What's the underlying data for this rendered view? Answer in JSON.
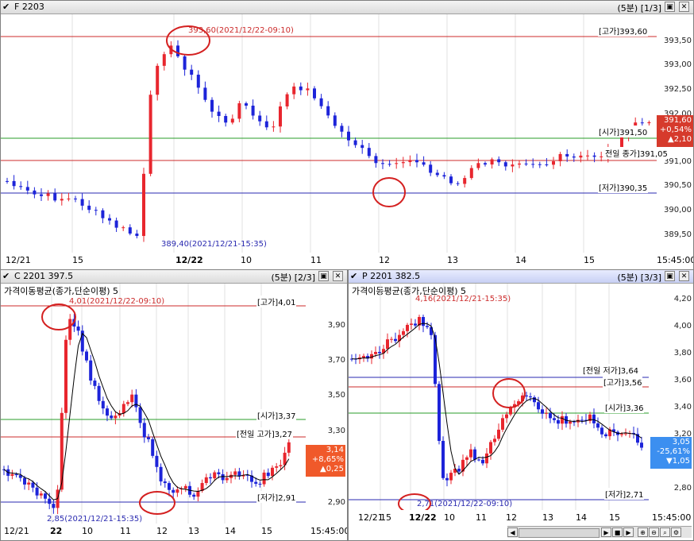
{
  "colors": {
    "up": "#e8262e",
    "down": "#1d24d9",
    "high_line": "#cc2b2b",
    "low_line": "#2a2ab0",
    "open_line": "#2a9d2a"
  },
  "panel1": {
    "check": "✔",
    "code": "F 2203",
    "period": "(5분)",
    "page": "[1/3]",
    "y_labels": [
      "393,50",
      "393,00",
      "392,50",
      "392,00",
      "391,00",
      "390,50",
      "390,00",
      "389,50"
    ],
    "x_labels": [
      "12/21",
      "15",
      "12/22",
      "10",
      "11",
      "12",
      "13",
      "14",
      "15",
      "15:45:00"
    ],
    "high_label": "[고가]393,60",
    "open_label": "[시가]391,50",
    "prev_close_label": "전일 종가]391,05",
    "low_label": "[저가]390,35",
    "high_annot": "393,60(2021/12/22-09:10)",
    "low_annot": "389,40(2021/12/21-15:35)",
    "price": {
      "last": "391,60",
      "change_pct": "+0,54%",
      "change": "▲2,10"
    }
  },
  "panel2": {
    "check": "✔",
    "code": "C 2201",
    "price_now": "397.5",
    "period": "(5분)",
    "page": "[2/3]",
    "indicator": "가격이동평균(종가,단순이평) 5",
    "y_labels": [
      "3,90",
      "3,70",
      "3,50",
      "3,30",
      "2,90"
    ],
    "x_labels": [
      "12/21",
      "22",
      "10",
      "11",
      "12",
      "13",
      "14",
      "15",
      "15:45:00"
    ],
    "high_label": "[고가]4,01",
    "open_label": "[시가]3,37",
    "prev_high_label": "[전일 고가]3,27",
    "low_label": "[저가]2,91",
    "high_annot": "4,01(2021/12/22-09:10)",
    "low_annot": "2,85(2021/12/21-15:35)",
    "price": {
      "last": "3,14",
      "change_pct": "+8,65%",
      "change": "▲0,25"
    }
  },
  "panel3": {
    "check": "✔",
    "code": "P 2201",
    "price_now": "382.5",
    "period": "(5분)",
    "page": "[3/3]",
    "indicator": "가격이동평균(종가,단순이평) 5",
    "y_labels": [
      "4,20",
      "4,00",
      "3,80",
      "3,60",
      "3,40",
      "3,20",
      "2,80"
    ],
    "x_labels": [
      "12/21",
      "15",
      "12/22",
      "10",
      "11",
      "12",
      "13",
      "14",
      "15",
      "15:45:00"
    ],
    "prev_low_label": "[전일 저가]3,64",
    "high_label": "[고가]3,56",
    "open_label": "[시가]3,36",
    "low_label": "[저가]2,71",
    "high_annot": "4,16(2021/12/21-15:35)",
    "low_annot": "2,71(2021/12/22-09:10)",
    "price": {
      "last": "3,05",
      "change_pct": "-25,61%",
      "change": "▼1,05"
    }
  }
}
